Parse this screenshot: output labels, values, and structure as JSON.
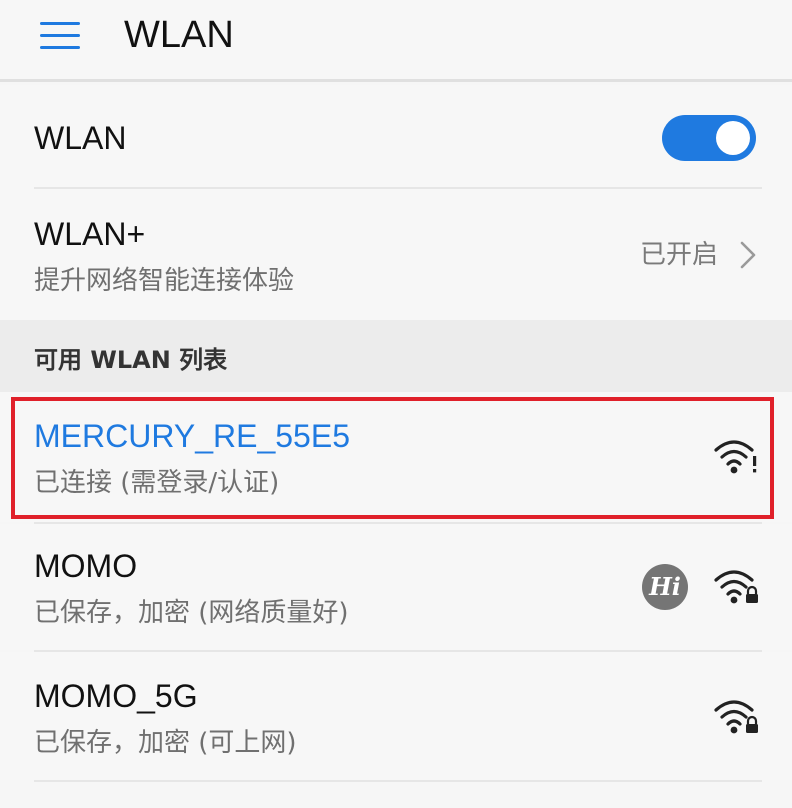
{
  "header": {
    "title": "WLAN",
    "menu_icon": "hamburger-menu-icon"
  },
  "wlan_toggle": {
    "label": "WLAN",
    "enabled": true,
    "accent_color": "#1f7ae0"
  },
  "wlan_plus": {
    "title": "WLAN+",
    "subtitle": "提升网络智能连接体验",
    "status": "已开启",
    "icon": "chevron-right-icon"
  },
  "section": {
    "label": "可用 WLAN 列表"
  },
  "networks": [
    {
      "name": "MERCURY_RE_55E5",
      "status": "已连接 (需登录/认证)",
      "icon": "wifi-warning-icon",
      "connected": true
    },
    {
      "name": "MOMO",
      "status": "已保存，加密 (网络质量好)",
      "badge": "Hi",
      "icon": "wifi-locked-icon"
    },
    {
      "name": "MOMO_5G",
      "status": "已保存，加密 (可上网)",
      "icon": "wifi-locked-icon"
    }
  ],
  "highlight_color": "#e0202a"
}
